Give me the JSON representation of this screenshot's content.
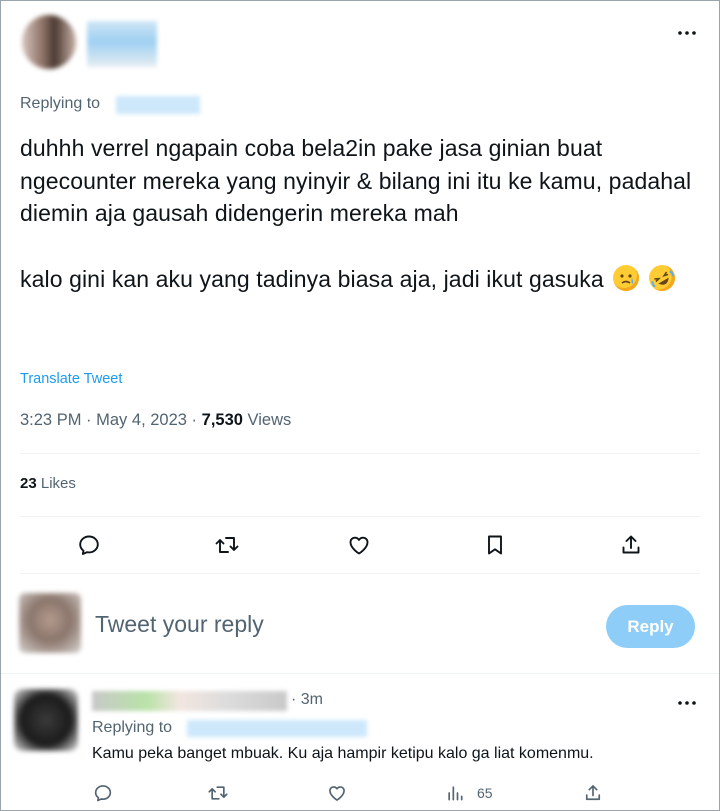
{
  "tweet": {
    "replying_label": "Replying to",
    "text_para1": "duhhh verrel ngapain coba bela2in pake jasa ginian buat ngecounter mereka yang nyinyir & bilang ini itu ke kamu, padahal diemin aja gausah didengerin mereka mah",
    "text_para2": "kalo gini kan aku yang tadinya biasa aja, jadi ikut gasuka",
    "emojis": [
      "crying-face-emoji",
      "rolling-on-floor-laughing-emoji"
    ],
    "translate_label": "Translate Tweet",
    "time": "3:23 PM",
    "date": "May 4, 2023",
    "views_count": "7,530",
    "views_label": "Views",
    "likes_count": "23",
    "likes_label": "Likes"
  },
  "actions": [
    "reply-icon",
    "retweet-icon",
    "like-icon",
    "bookmark-icon",
    "share-icon"
  ],
  "composer": {
    "placeholder": "Tweet your reply",
    "button_label": "Reply"
  },
  "comment": {
    "time": "· 3m",
    "replying_label": "Replying to",
    "text": "Kamu peka banget mbuak. Ku aja hampir ketipu kalo ga liat komenmu.",
    "views_count": "65"
  },
  "colors": {
    "accent": "#1d9bf0",
    "reply_button_disabled": "#8ecdf8",
    "secondary_text": "#536471",
    "divider": "#eff3f4"
  }
}
